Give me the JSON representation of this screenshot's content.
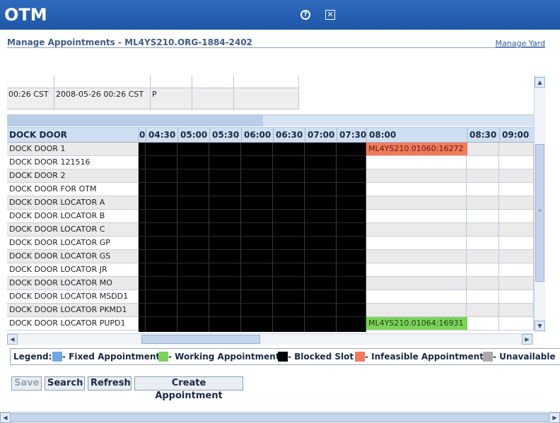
{
  "app": {
    "brand": "OTM"
  },
  "page": {
    "title": "Manage Appointments - ML4YS210.ORG-1884-2402",
    "manage_yard_link": "Manage Yard"
  },
  "upper_table": {
    "cells": [
      "00:26 CST",
      "2008-05-26 00:26 CST",
      "P",
      "",
      ""
    ]
  },
  "grid": {
    "header": {
      "door_label": "DOCK DOOR",
      "partial_col": "0",
      "times": [
        "04:30",
        "05:00",
        "05:30",
        "06:00",
        "06:30",
        "07:00",
        "07:30",
        "08:00",
        "08:30",
        "09:00"
      ]
    },
    "rows": [
      {
        "door": "DOCK DOOR 1"
      },
      {
        "door": "DOCK DOOR 121516"
      },
      {
        "door": "DOCK DOOR 2"
      },
      {
        "door": "DOCK DOOR FOR OTM"
      },
      {
        "door": "DOCK DOOR LOCATOR A"
      },
      {
        "door": "DOCK DOOR LOCATOR B"
      },
      {
        "door": "DOCK DOOR LOCATOR C"
      },
      {
        "door": "DOCK DOOR LOCATOR GP"
      },
      {
        "door": "DOCK DOOR LOCATOR GS"
      },
      {
        "door": "DOCK DOOR LOCATOR JR"
      },
      {
        "door": "DOCK DOOR LOCATOR MO"
      },
      {
        "door": "DOCK DOOR LOCATOR MSDD1"
      },
      {
        "door": "DOCK DOOR LOCATOR PKMD1"
      },
      {
        "door": "DOCK DOOR LOCATOR PUPD1"
      }
    ],
    "appointments": [
      {
        "label": "ML4YS210.01060:16272",
        "row": 0,
        "type": "infeasible"
      },
      {
        "label": "ML4YS210.01064:16931",
        "row": 13,
        "type": "working"
      }
    ]
  },
  "legend": {
    "title": "Legend:",
    "items": [
      {
        "label": "- Fixed Appointment",
        "color": "#6fa8e8"
      },
      {
        "label": "- Working Appointment",
        "color": "#7dd35a"
      },
      {
        "label": "- Blocked Slot",
        "color": "#000000"
      },
      {
        "label": "- Infeasible Appointment",
        "color": "#f47a5c"
      },
      {
        "label": "- Unavailable",
        "color": "#a9a9a9"
      }
    ]
  },
  "buttons": {
    "save": "Save",
    "search": "Search",
    "refresh": "Refresh",
    "create": "Create Appointment"
  },
  "colors": {
    "infeasible": "#f47a5c",
    "working": "#7dd35a",
    "blocked": "#000000",
    "header_bg": "#cfdff2",
    "title_bar": "#1f56a6"
  }
}
